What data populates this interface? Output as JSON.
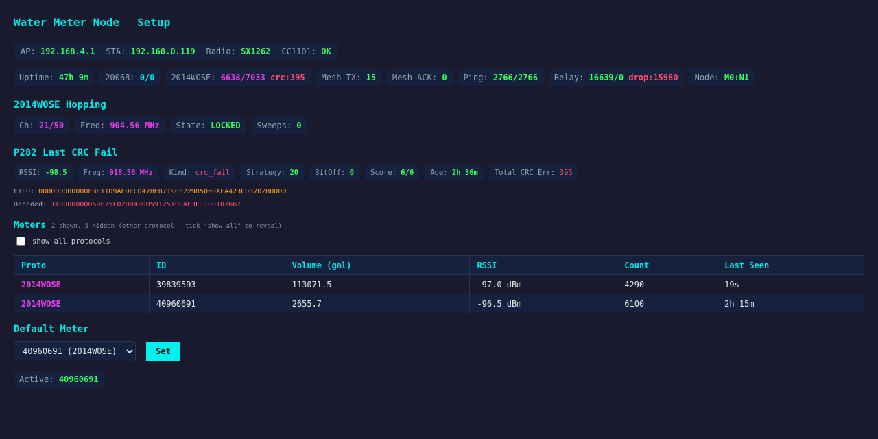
{
  "header": {
    "title": "Water Meter Node",
    "setup_link": "Setup"
  },
  "status_bar_1": [
    {
      "label": "AP:",
      "value": "192.168.4.1"
    },
    {
      "label": "STA:",
      "value": "192.168.0.119"
    },
    {
      "label": "Radio:",
      "value": "SX1262"
    },
    {
      "label": "CC1101:",
      "value": "OK"
    }
  ],
  "status_bar_2": {
    "uptime": {
      "label": "Uptime:",
      "value": "47h 9m"
    },
    "p2006b": {
      "label": "2006B:",
      "value": "0/0"
    },
    "p2014wose": {
      "label": "2014WOSE:",
      "value": "6638/7033",
      "crc": "crc:395"
    },
    "mesh_tx": {
      "label": "Mesh TX:",
      "value": "15"
    },
    "mesh_ack": {
      "label": "Mesh ACK:",
      "value": "0"
    },
    "ping": {
      "label": "Ping:",
      "value": "2766/2766"
    },
    "relay": {
      "label": "Relay:",
      "value": "16639/0",
      "drop": "drop:15980"
    },
    "node": {
      "label": "Node:",
      "value": "M0:N1"
    }
  },
  "hopping": {
    "heading": "2014WOSE Hopping",
    "ch": {
      "label": "Ch:",
      "value": "21/50"
    },
    "freq": {
      "label": "Freq:",
      "value": "904.56 MHz"
    },
    "state": {
      "label": "State:",
      "value": "LOCKED"
    },
    "sweeps": {
      "label": "Sweeps:",
      "value": "0"
    }
  },
  "crc_fail": {
    "heading": "P282 Last CRC Fail",
    "rssi": {
      "label": "RSSI:",
      "value": "-98.5"
    },
    "freq": {
      "label": "Freq:",
      "value": "918.56 MHz"
    },
    "kind": {
      "label": "Kind:",
      "value": "crc_fail"
    },
    "strategy": {
      "label": "Strategy:",
      "value": "20"
    },
    "bitoff": {
      "label": "BitOff:",
      "value": "0"
    },
    "score": {
      "label": "Score:",
      "value": "6/6"
    },
    "age": {
      "label": "Age:",
      "value": "2h 36m"
    },
    "total": {
      "label": "Total CRC Err:",
      "value": "395"
    },
    "fifo": {
      "label": "FIFO:",
      "value": "000000000000EBE11D9AEDECD47BE87190322985060AFA423CD87D7BDD00"
    },
    "decoded": {
      "label": "Decoded:",
      "value": "140000000069E75F020B420B59125100AE3F1100107667"
    }
  },
  "meters": {
    "heading": "Meters",
    "subtitle": "2 shown, 5 hidden (other protocol — tick \"show all\" to reveal)",
    "show_all_label": "show all protocols",
    "columns": [
      "Proto",
      "ID",
      "Volume (gal)",
      "RSSI",
      "Count",
      "Last Seen"
    ],
    "rows": [
      [
        "2014WOSE",
        "39839593",
        "113071.5",
        "-97.0 dBm",
        "4290",
        "19s"
      ],
      [
        "2014WOSE",
        "40960691",
        "2655.7",
        "-96.5 dBm",
        "6100",
        "2h 15m"
      ]
    ]
  },
  "default_meter": {
    "heading": "Default Meter",
    "selected": "40960691 (2014WOSE)",
    "set_label": "Set",
    "active_label": "Active:",
    "active_value": "40960691"
  },
  "colors": {
    "background": "#1a1a2e",
    "panel": "#16213e",
    "accent": "#00e5e5",
    "good": "#39ff5a",
    "magenta": "#e53ee5",
    "bad": "#ff4d6d",
    "orange": "#ff9f1c"
  }
}
